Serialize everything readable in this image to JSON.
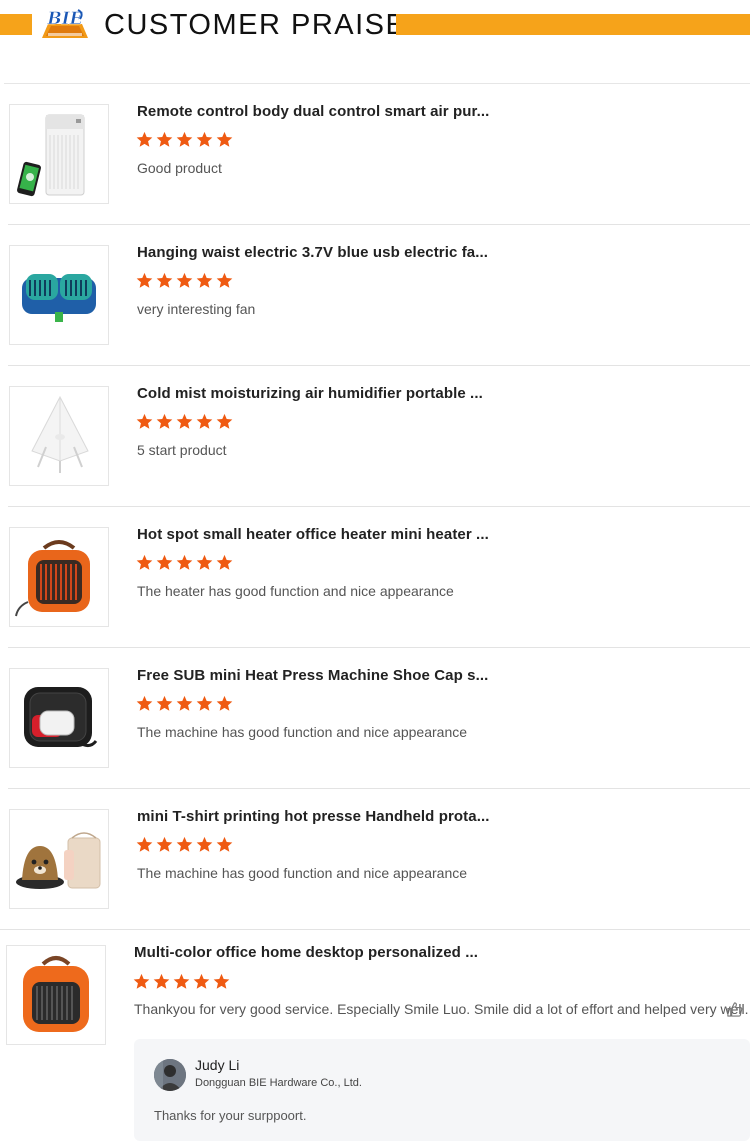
{
  "header": {
    "title": "CUSTOMER PRAISE",
    "accent_color": "#f6a31a",
    "logo_text": "BIE"
  },
  "star_color": "#ef5a12",
  "reviews": [
    {
      "title": "Remote control body dual control smart air pur...",
      "rating": 5,
      "comment": "Good product",
      "thumb_icon": "air-purifier-image"
    },
    {
      "title": "Hanging waist electric 3.7V blue usb electric fa...",
      "rating": 5,
      "comment": "very interesting fan",
      "thumb_icon": "waist-fan-image"
    },
    {
      "title": "Cold mist moisturizing air humidifier portable ...",
      "rating": 5,
      "comment": "5 start product",
      "thumb_icon": "humidifier-image"
    },
    {
      "title": "Hot spot small heater office heater mini heater ...",
      "rating": 5,
      "comment": "The heater has good function and nice appearance",
      "thumb_icon": "mini-heater-image"
    },
    {
      "title": "Free SUB mini Heat Press Machine Shoe Cap s...",
      "rating": 5,
      "comment": "The machine has good function and nice appearance",
      "thumb_icon": "heat-press-case-image"
    },
    {
      "title": "mini T-shirt printing hot presse Handheld prota...",
      "rating": 5,
      "comment": "The machine has good function and nice appearance",
      "thumb_icon": "handheld-press-image"
    }
  ],
  "last_review": {
    "title": "Multi-color office home desktop personalized ...",
    "rating": 5,
    "comment": "Thankyou for very good service. Especially Smile Luo. Smile did a lot of effort and helped very well.",
    "thumb_icon": "orange-heater-image",
    "reply": {
      "name": "Judy Li",
      "company": "Dongguan BIE Hardware Co., Ltd.",
      "text": "Thanks for your surppoort."
    }
  }
}
